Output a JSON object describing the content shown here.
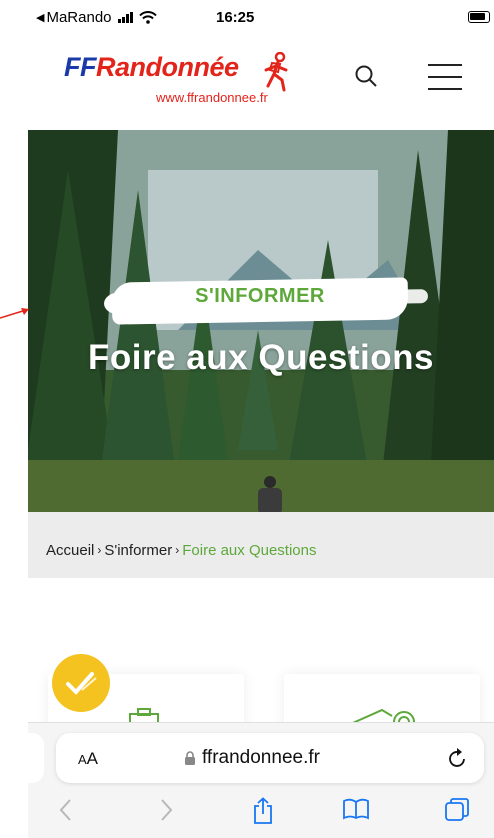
{
  "status_bar": {
    "carrier": "MaRando",
    "time": "16:25"
  },
  "header": {
    "logo_text_ff": "FF",
    "logo_text_rand": "Randonnée",
    "logo_url": "www.ffrandonnee.fr"
  },
  "hero": {
    "kicker": "S'INFORMER",
    "title": "Foire aux Questions"
  },
  "breadcrumb": {
    "items": [
      "Accueil",
      "S'informer",
      "Foire aux Questions"
    ],
    "separator": "›"
  },
  "browser": {
    "aa_label_small": "A",
    "aa_label_big": "A",
    "address": "ffrandonnee.fr"
  },
  "colors": {
    "accent_green": "#5ea83b",
    "brand_blue": "#1a3aa8",
    "brand_red": "#e3241b",
    "badge_yellow": "#f4c320",
    "safari_blue": "#1877f2"
  },
  "icons": [
    "signal-bars-icon",
    "wifi-icon",
    "battery-icon",
    "hiker-logo-icon",
    "search-icon",
    "menu-icon",
    "lock-icon",
    "reload-icon",
    "back-icon",
    "forward-icon",
    "share-icon",
    "bookmarks-icon",
    "tabs-icon",
    "checkmark-icon"
  ]
}
